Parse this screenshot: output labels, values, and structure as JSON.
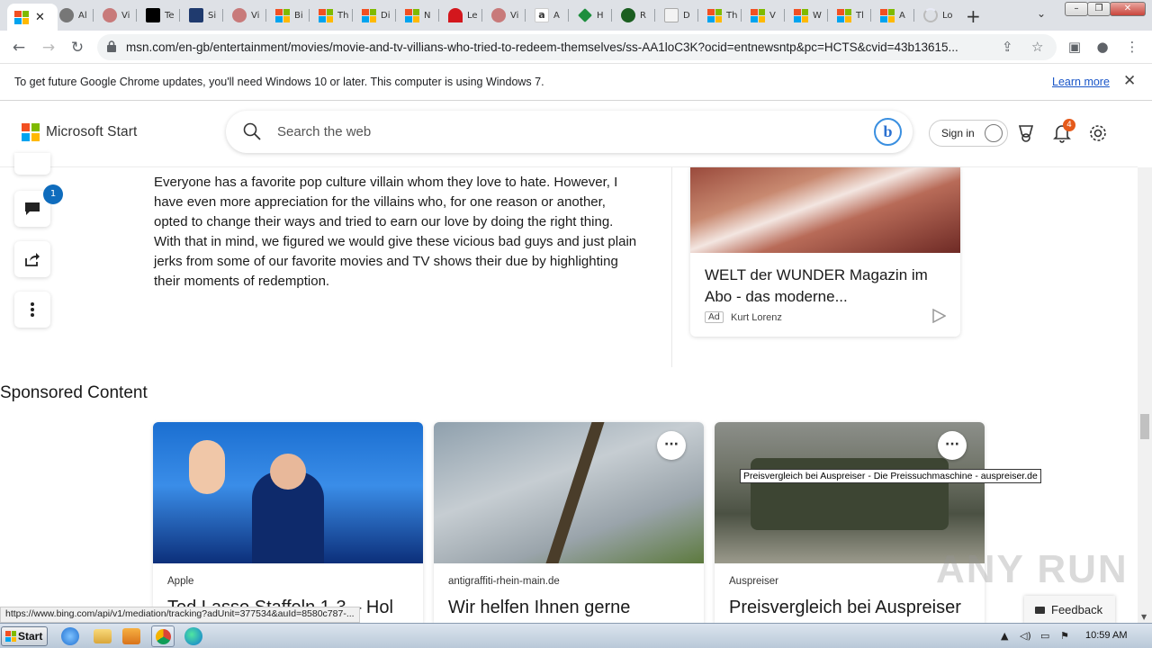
{
  "browser": {
    "tabs": [
      {
        "label": "",
        "icon": "msn-icon",
        "color": "#f25022",
        "active": true
      },
      {
        "label": "Al",
        "icon": "pen-icon",
        "color": "#555555"
      },
      {
        "label": "Vi",
        "icon": "web-icon",
        "color": "#c0504d"
      },
      {
        "label": "Te",
        "icon": "appletv-icon",
        "color": "#000000"
      },
      {
        "label": "Si",
        "icon": "mb-icon",
        "color": "#1f3a6e"
      },
      {
        "label": "Vi",
        "icon": "web-icon",
        "color": "#c0504d"
      },
      {
        "label": "Bi",
        "icon": "msn-icon",
        "color": "#f25022"
      },
      {
        "label": "Th",
        "icon": "msn-icon",
        "color": "#f25022"
      },
      {
        "label": "Di",
        "icon": "msn-icon",
        "color": "#f25022"
      },
      {
        "label": "N",
        "icon": "msn-icon",
        "color": "#f25022"
      },
      {
        "label": "Le",
        "icon": "red-icon",
        "color": "#d3171d"
      },
      {
        "label": "Vi",
        "icon": "web-icon",
        "color": "#c0504d"
      },
      {
        "label": "A",
        "icon": "amazon-icon",
        "color": "#222222"
      },
      {
        "label": "H",
        "icon": "tag-icon",
        "color": "#1e8e3e"
      },
      {
        "label": "R",
        "icon": "circle-icon",
        "color": "#1b5e20"
      },
      {
        "label": "D",
        "icon": "cecil-icon",
        "color": "#888888"
      },
      {
        "label": "Th",
        "icon": "msn-icon",
        "color": "#f25022"
      },
      {
        "label": "V",
        "icon": "msn-icon",
        "color": "#f25022"
      },
      {
        "label": "W",
        "icon": "msn-icon",
        "color": "#f25022"
      },
      {
        "label": "Tl",
        "icon": "msn-icon",
        "color": "#f25022"
      },
      {
        "label": "A",
        "icon": "msn-icon",
        "color": "#f25022"
      },
      {
        "label": "Lo",
        "icon": "loading-icon",
        "color": "#bbbbbb"
      }
    ],
    "new_tab": "+",
    "url": "msn.com/en-gb/entertainment/movies/movie-and-tv-villians-who-tried-to-redeem-themselves/ss-AA1loC3K?ocid=entnewsntp&pc=HCTS&cvid=43b13615...",
    "infobar": {
      "message": "To get future Google Chrome updates, you'll need Windows 10 or later. This computer is using Windows 7.",
      "link": "Learn more"
    }
  },
  "msstart": {
    "brand": "Microsoft Start",
    "search_placeholder": "Search the web",
    "signin": "Sign in",
    "notification_count": "4",
    "comments_count": "1"
  },
  "article": {
    "body": "Everyone has a favorite pop culture villain whom they love to hate. However, I have even more appreciation for the villains who, for one reason or another, opted to change their ways and tried to earn our love by doing the right thing. With that in mind, we figured we would give these vicious bad guys and just plain jerks from some of our favorite movies and TV shows their due by highlighting their moments of redemption."
  },
  "ad": {
    "title": "WELT der WUNDER Magazin im Abo - das moderne...",
    "tag": "Ad",
    "source": "Kurt Lorenz"
  },
  "sponsored": {
    "heading": "Sponsored Content",
    "cards": [
      {
        "source": "Apple",
        "title": "Ted Lasso Staffeln 1-3 – Hol"
      },
      {
        "source": "antigraffiti-rhein-main.de",
        "title": "Wir helfen Ihnen gerne"
      },
      {
        "source": "Auspreiser",
        "title": "Preisvergleich bei Auspreiser"
      }
    ],
    "tooltip": "Preisvergleich bei Auspreiser - Die Preissuchmaschine - auspreiser.de"
  },
  "feedback": "Feedback",
  "watermark": "ANY RUN",
  "status_url": "https://www.bing.com/api/v1/mediation/tracking?adUnit=377534&auId=8580c787-...",
  "taskbar": {
    "start": "Start",
    "clock": "10:59 AM"
  }
}
